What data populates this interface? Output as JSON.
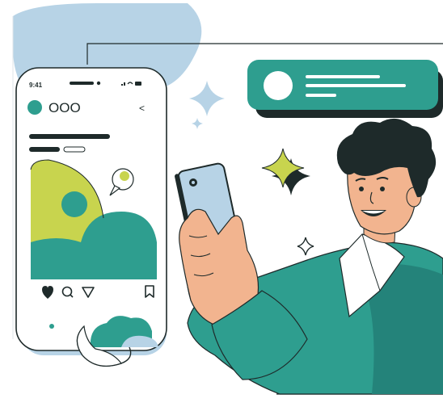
{
  "colors": {
    "teal": "#2e9e8f",
    "teal_dark": "#24837a",
    "lime": "#c8d44e",
    "light_blue": "#b7d3e6",
    "ink": "#1e2a2a",
    "skin": "#f2b48f",
    "skin_shadow": "#e29a78",
    "white": "#ffffff"
  },
  "phone": {
    "status_time": "9:41",
    "profile_name": "OOO",
    "back_glyph": "<"
  },
  "icons": [
    "heart-icon",
    "search-icon",
    "send-icon",
    "bookmark-icon",
    "sparkle-icon",
    "avatar-icon"
  ]
}
